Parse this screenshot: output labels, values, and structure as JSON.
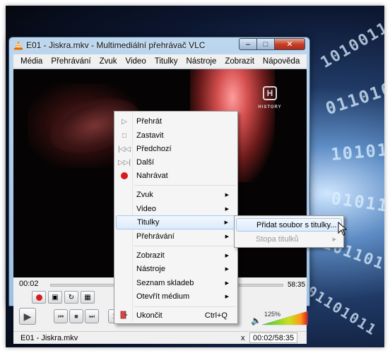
{
  "window": {
    "title": "E01 - Jiskra.mkv - Multimediální přehrávač VLC",
    "controls": {
      "minimize": "‒",
      "maximize": "□",
      "close": "✕"
    }
  },
  "menubar": [
    "Média",
    "Přehrávání",
    "Zvuk",
    "Video",
    "Titulky",
    "Nástroje",
    "Zobrazit",
    "Nápověda"
  ],
  "video": {
    "channel_logo_text": "HISTORY"
  },
  "player": {
    "time_elapsed": "00:02",
    "time_remaining": "58:35",
    "volume_label": "125%",
    "volume_level": 1.25
  },
  "status": {
    "file": "E01 - Jiskra.mkv",
    "speed": "x",
    "time": "00:02/58:35"
  },
  "context_menu": {
    "items": [
      {
        "label": "Přehrát",
        "icon": "play-icon"
      },
      {
        "label": "Zastavit",
        "icon": "stop-icon"
      },
      {
        "label": "Předchozí",
        "icon": "previous-icon"
      },
      {
        "label": "Další",
        "icon": "next-icon"
      },
      {
        "label": "Nahrávat",
        "icon": "record-icon"
      },
      {
        "label": "Zvuk",
        "submenu": true
      },
      {
        "label": "Video",
        "submenu": true
      },
      {
        "label": "Titulky",
        "submenu": true,
        "highlighted": true
      },
      {
        "label": "Přehrávání",
        "submenu": true
      },
      {
        "label": "Zobrazit",
        "submenu": true
      },
      {
        "label": "Nástroje",
        "submenu": true
      },
      {
        "label": "Seznam skladeb",
        "submenu": true
      },
      {
        "label": "Otevřít médium",
        "submenu": true
      },
      {
        "label": "Ukončit",
        "icon": "quit-icon",
        "shortcut": "Ctrl+Q"
      }
    ]
  },
  "submenu": {
    "items": [
      {
        "label": "Přidat soubor s titulky...",
        "highlighted": true
      },
      {
        "label": "Stopa titulků",
        "submenu": true,
        "disabled": true
      }
    ]
  }
}
